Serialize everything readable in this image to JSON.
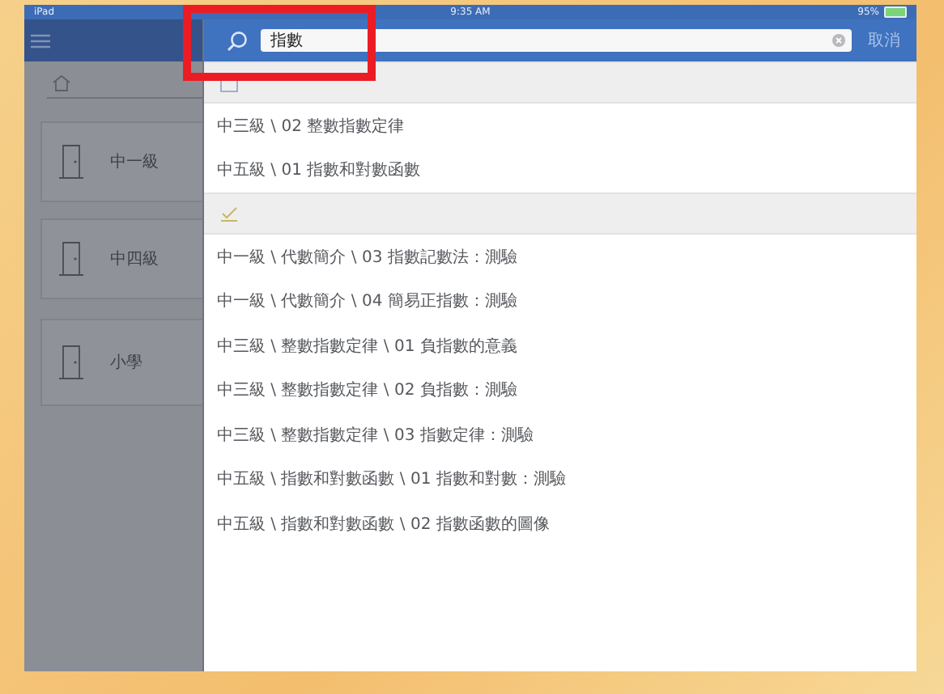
{
  "status_bar": {
    "device": "iPad",
    "time": "9:35 AM",
    "battery": "95%"
  },
  "sidebar": {
    "items": [
      {
        "label": "中一級"
      },
      {
        "label": "中四級"
      },
      {
        "label": "小學"
      }
    ]
  },
  "search": {
    "value": "指數",
    "cancel": "取消"
  },
  "sections": [
    {
      "kind": "book",
      "rows": [
        "中三級 \\ 02 整數指數定律",
        "中五級 \\ 01 指數和對數函數"
      ]
    },
    {
      "kind": "quiz",
      "rows": [
        "中一級 \\ 代數簡介 \\ 03 指數記數法：測驗",
        "中一級 \\ 代數簡介 \\ 04 簡易正指數：測驗",
        "中三級 \\ 整數指數定律 \\ 01 負指數的意義",
        "中三級 \\ 整數指數定律 \\ 02 負指數：測驗",
        "中三級 \\ 整數指數定律 \\ 03 指數定律：測驗",
        "中五級 \\ 指數和對數函數 \\ 01 指數和對數：測驗",
        "中五級 \\ 指數和對數函數 \\ 02 指數函數的圖像"
      ]
    }
  ]
}
